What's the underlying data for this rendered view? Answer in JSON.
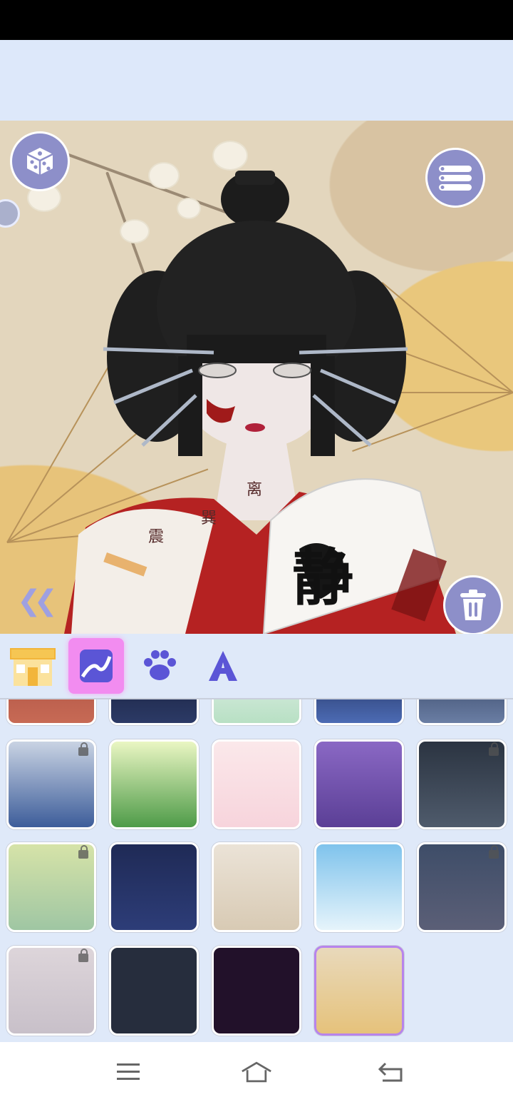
{
  "canvas": {
    "tattoos": [
      "离",
      "巽",
      "震"
    ],
    "fan_glyph": "静"
  },
  "buttons": {
    "random_icon": "dice-icon",
    "menu_icon": "list-icon",
    "delete_icon": "trash-icon",
    "collapse_icon": "double-chevron-left-icon"
  },
  "tabs": [
    {
      "icon": "shop-icon",
      "active": false
    },
    {
      "icon": "background-image-icon",
      "active": true
    },
    {
      "icon": "paw-icon",
      "active": false
    },
    {
      "icon": "text-a-icon",
      "active": false
    }
  ],
  "backgrounds": [
    {
      "name": "mars",
      "locked": false,
      "colors": [
        "#a3483c",
        "#c76a55"
      ]
    },
    {
      "name": "moon-night",
      "locked": false,
      "colors": [
        "#0d1428",
        "#2c3a66"
      ]
    },
    {
      "name": "lily-pond",
      "locked": false,
      "colors": [
        "#f1f6f6",
        "#b8e0c4"
      ]
    },
    {
      "name": "starry-mountains",
      "locked": false,
      "colors": [
        "#0e1533",
        "#4c6bb4"
      ]
    },
    {
      "name": "night-sparkle",
      "locked": false,
      "colors": [
        "#1b2642",
        "#6a7ea4"
      ]
    },
    {
      "name": "blue-bamboo",
      "locked": true,
      "colors": [
        "#c9d3e3",
        "#3d5d9a"
      ]
    },
    {
      "name": "green-mountain",
      "locked": false,
      "colors": [
        "#eaf6c3",
        "#4e9b48"
      ]
    },
    {
      "name": "pink-pattern",
      "locked": false,
      "colors": [
        "#fbe8ea",
        "#f7d4dc"
      ]
    },
    {
      "name": "purple-clouds",
      "locked": false,
      "colors": [
        "#8a68c4",
        "#5b3f96"
      ]
    },
    {
      "name": "spider-web",
      "locked": true,
      "colors": [
        "#2b3441",
        "#4f5b6c"
      ]
    },
    {
      "name": "golden-waves",
      "locked": true,
      "colors": [
        "#d6e3a8",
        "#9fc6a3"
      ]
    },
    {
      "name": "sea-waves-night",
      "locked": false,
      "colors": [
        "#1f2a56",
        "#2d3d78"
      ]
    },
    {
      "name": "ivy-wall",
      "locked": false,
      "colors": [
        "#ebe3d7",
        "#d8cab4"
      ]
    },
    {
      "name": "cloud-sky",
      "locked": false,
      "colors": [
        "#7fc3ec",
        "#e6f4fb"
      ]
    },
    {
      "name": "dusk-moon",
      "locked": true,
      "colors": [
        "#3e4d68",
        "#5b5f77"
      ]
    },
    {
      "name": "lace",
      "locked": true,
      "colors": [
        "#ddd5da",
        "#c8c0c9"
      ]
    },
    {
      "name": "teal-splash",
      "locked": false,
      "colors": [
        "#262d3d",
        "#262d3d"
      ]
    },
    {
      "name": "pink-bubbles",
      "locked": false,
      "colors": [
        "#22112a",
        "#22112a"
      ]
    },
    {
      "name": "golden-fans",
      "locked": false,
      "selected": true,
      "colors": [
        "#e8d9bb",
        "#e6c27b"
      ]
    }
  ],
  "navbar": {
    "menu_icon": "menu-icon",
    "home_icon": "home-icon",
    "back_icon": "back-icon"
  }
}
